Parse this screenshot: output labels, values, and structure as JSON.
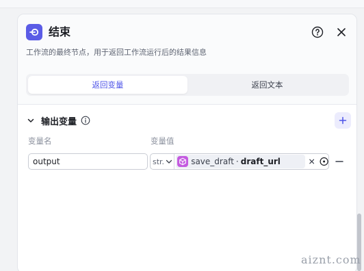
{
  "node": {
    "title": "结束",
    "icon": "end-node-icon",
    "description": "工作流的最终节点，用于返回工作流运行后的结果信息",
    "accent_color": "#5b5ce6"
  },
  "tabs": [
    {
      "label": "返回变量",
      "active": true
    },
    {
      "label": "返回文本",
      "active": false
    }
  ],
  "output_section": {
    "title": "输出变量",
    "columns": {
      "name": "变量名",
      "value": "变量值"
    },
    "rows": [
      {
        "name": "output",
        "type": "str.",
        "ref_node": "save_draft",
        "ref_separator": "·",
        "ref_variable": "draft_url"
      }
    ]
  },
  "watermark": "aiznt.com"
}
